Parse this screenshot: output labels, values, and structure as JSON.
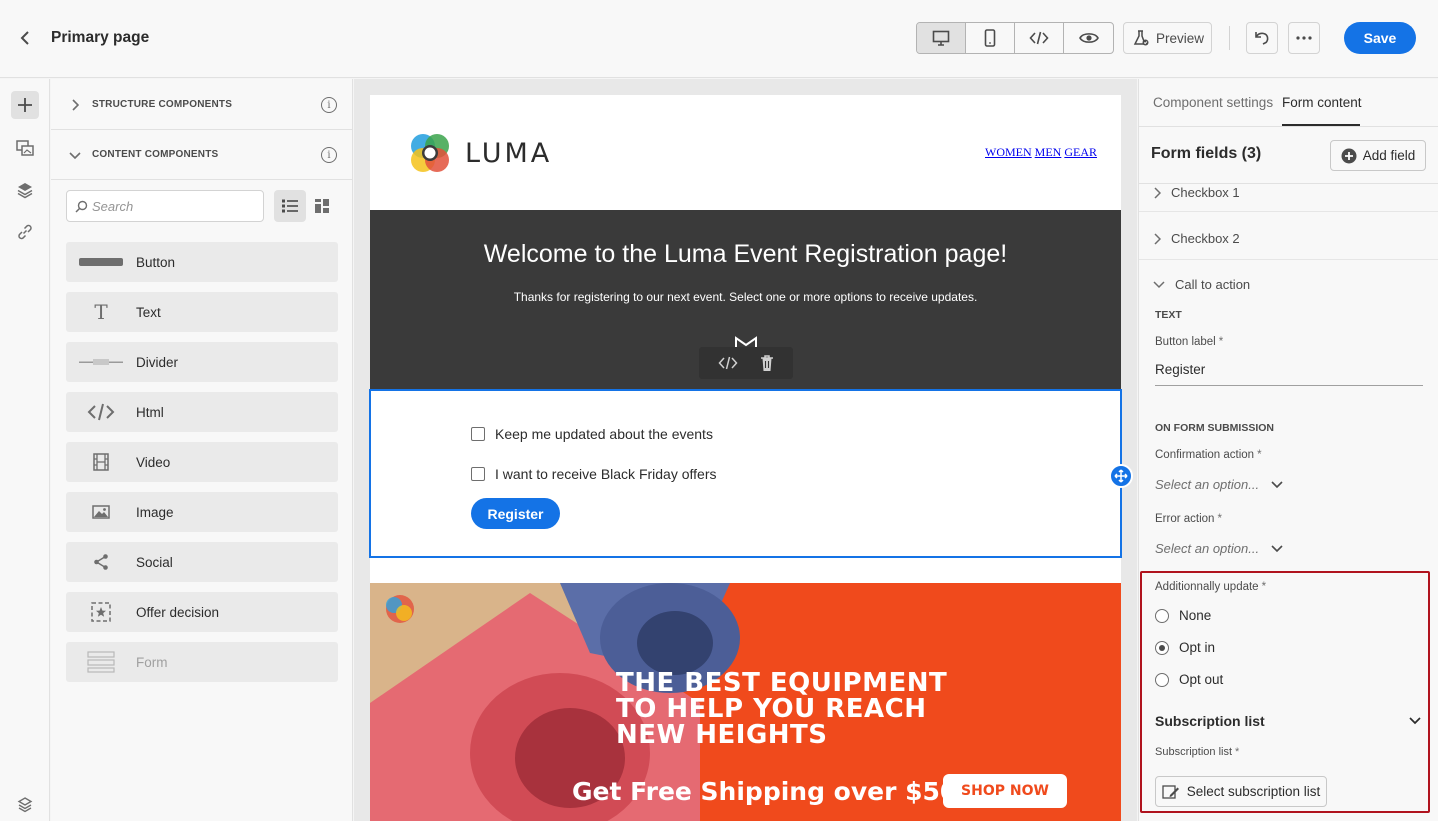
{
  "header": {
    "title": "Primary page",
    "preview_label": "Preview",
    "save_label": "Save",
    "view_modes": [
      "desktop-icon",
      "mobile-icon",
      "code-icon",
      "eye-icon"
    ]
  },
  "left_panel": {
    "sections": [
      {
        "label": "STRUCTURE COMPONENTS",
        "expanded": false
      },
      {
        "label": "CONTENT COMPONENTS",
        "expanded": true
      }
    ],
    "search_placeholder": "Search",
    "components": [
      {
        "label": "Button",
        "icon": "button-icon",
        "enabled": true
      },
      {
        "label": "Text",
        "icon": "text-icon",
        "enabled": true
      },
      {
        "label": "Divider",
        "icon": "divider-icon",
        "enabled": true
      },
      {
        "label": "Html",
        "icon": "code-icon",
        "enabled": true
      },
      {
        "label": "Video",
        "icon": "video-icon",
        "enabled": true
      },
      {
        "label": "Image",
        "icon": "image-icon",
        "enabled": true
      },
      {
        "label": "Social",
        "icon": "share-icon",
        "enabled": true
      },
      {
        "label": "Offer decision",
        "icon": "offer-decision-icon",
        "enabled": true
      },
      {
        "label": "Form",
        "icon": "form-icon",
        "enabled": false
      }
    ]
  },
  "email": {
    "brand": "LUMA",
    "nav": [
      "WOMEN",
      "MEN",
      "GEAR"
    ],
    "hero_title": "Welcome to the Luma Event Registration page!",
    "hero_subtitle": "Thanks for registering to our next event. Select one or more options to receive updates.",
    "checkboxes": [
      "Keep me updated about the events",
      "I want to receive Black Friday offers"
    ],
    "register_label": "Register",
    "banner": {
      "line1": "THE BEST EQUIPMENT",
      "line2": "TO HELP YOU REACH",
      "line3": "NEW HEIGHTS",
      "shipping": "Get Free Shipping over $50",
      "cta": "SHOP NOW"
    }
  },
  "right_panel": {
    "tabs": [
      "Component settings",
      "Form content"
    ],
    "active_tab": "Form content",
    "form_fields_title": "Form fields (3)",
    "add_field_label": "Add field",
    "fields": [
      "Checkbox 1",
      "Checkbox 2",
      "Call to action"
    ],
    "text_section": "TEXT",
    "button_label_label": "Button label",
    "button_label_value": "Register",
    "submission_section": "ON FORM SUBMISSION",
    "confirmation_label": "Confirmation action",
    "confirmation_value": "Select an option...",
    "error_label": "Error action",
    "error_value": "Select an option...",
    "additionally_label": "Additionnally update",
    "update_options": [
      "None",
      "Opt in",
      "Opt out"
    ],
    "update_selected": "Opt in",
    "subscription_title": "Subscription list",
    "subscription_field_label": "Subscription list",
    "select_subscription_label": "Select subscription list",
    "required_mark": "*",
    "highlight_color": "#b0131e"
  },
  "colors": {
    "accent": "#1473e6",
    "hero_bg": "#3a3a3a",
    "banner_bg": "#f04a1c"
  }
}
